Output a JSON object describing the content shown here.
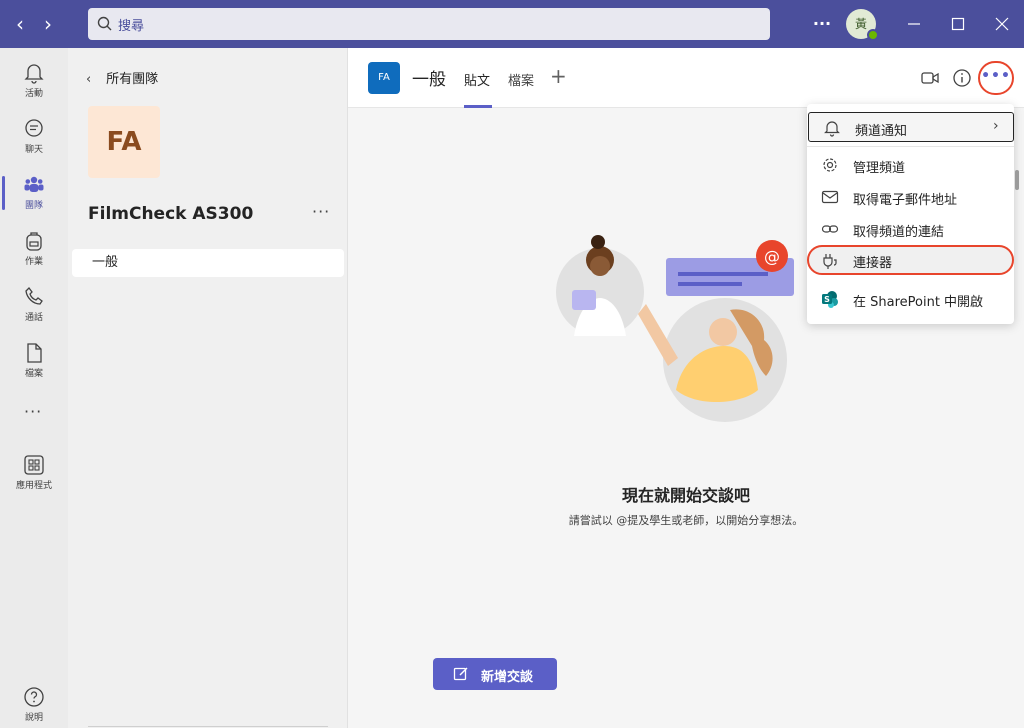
{
  "search": {
    "placeholder": "搜尋"
  },
  "titlebar": {
    "more": "···",
    "avatar_text": "黃"
  },
  "rail": [
    {
      "label": "活動",
      "icon": "bell-icon"
    },
    {
      "label": "聊天",
      "icon": "chat-icon"
    },
    {
      "label": "團隊",
      "icon": "teams-icon"
    },
    {
      "label": "作業",
      "icon": "backpack-icon"
    },
    {
      "label": "通話",
      "icon": "phone-icon"
    },
    {
      "label": "檔案",
      "icon": "file-icon"
    },
    {
      "label": "應用程式",
      "icon": "apps-icon"
    },
    {
      "label": "說明",
      "icon": "help-icon"
    }
  ],
  "rail_more": "···",
  "team_panel": {
    "back_label": "所有團隊",
    "team_initials": "FA",
    "team_name": "FilmCheck AS300",
    "more": "···",
    "channels": [
      "一般"
    ]
  },
  "channel": {
    "avatar": "FA",
    "name": "一般",
    "tabs": [
      "貼文",
      "檔案"
    ],
    "add_tab": "+",
    "more": "•••"
  },
  "main": {
    "empty_title": "現在就開始交談吧",
    "empty_subtitle": "請嘗試以 @提及學生或老師，以開始分享想法。",
    "new_conversation": "新增交談"
  },
  "menu": {
    "items": [
      {
        "label": "頻道通知",
        "icon": "bell-icon"
      },
      {
        "label": "管理頻道",
        "icon": "gear-icon"
      },
      {
        "label": "取得電子郵件地址",
        "icon": "mail-icon"
      },
      {
        "label": "取得頻道的連結",
        "icon": "link-icon"
      },
      {
        "label": "連接器",
        "icon": "connector-icon"
      },
      {
        "label": "在 SharePoint 中開啟",
        "icon": "sharepoint-icon"
      }
    ]
  },
  "colors": {
    "brand": "#5b5fc7",
    "titlebar": "#4b4f9c",
    "highlight_ring": "#e8452c"
  }
}
